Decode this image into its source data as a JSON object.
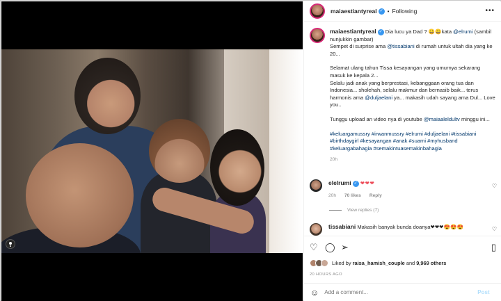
{
  "post": {
    "username": "maiaestiantyreal",
    "following_label": "Following",
    "more_label": "•••"
  },
  "caption": {
    "username": "maiaestiantyreal",
    "line1_a": " Dia lucu ya Dad ? 😀😀kata ",
    "line1_mention": "@elrumi",
    "line1_b": " (sambil nunjukkin gambar)",
    "line2_a": "Sempet di surprise ama ",
    "line2_mention": "@tissabiani",
    "line2_b": " di rumah untuk ultah dia yang ke 20...",
    "para2": "Selamat ulang tahun Tissa kesayangan yang umurnya sekarang masuk ke kepala 2...\nSelalu jadi anak yang berprestasi, kebanggaan orang tua dan Indonesia... sholehah, selalu makmur dan bernasib baik... terus harmonis ama ",
    "para2_mention": "@duljaelani",
    "para2_b": " ya... makasih udah sayang ama Dul... Love you..",
    "para3_a": "Tunggu upload an video nya di youtube ",
    "para3_mention": "@maiaaleldultv",
    "para3_b": " minggu ini...",
    "hashtags": "#keluargamussry #irwanmussry #elrumi #duljaelani #tissabiani #birthdaygirl #kesayangan #anak #suami #myhusband #keluargabahagia #semakintuasemakinbahagia",
    "time": "20h"
  },
  "comments": [
    {
      "username": "elelrumi",
      "text": "❤❤❤",
      "time": "20h",
      "likes": "70 likes",
      "reply_label": "Reply",
      "view_replies": "View replies (7)"
    },
    {
      "username": "tissabiani",
      "text": " Makasih banyak bunda doanya❤❤❤😍😍😍"
    }
  ],
  "likes": {
    "prefix": "Liked by ",
    "user": "raisa_hamish_couple",
    "middle": " and ",
    "count": "9,969 others"
  },
  "timestamp": "20 HOURS AGO",
  "add_comment": {
    "placeholder": "Add a comment...",
    "post_label": "Post"
  },
  "icons": {
    "verified": "verified-badge-icon",
    "like": "heart-icon",
    "comment": "comment-icon",
    "share": "share-icon",
    "save": "bookmark-icon",
    "emoji": "emoji-icon",
    "tagged": "user-tag-icon"
  },
  "colors": {
    "mention": "#00376b",
    "verified": "#3897f0",
    "heart": "#ed4956",
    "post_disabled": "#b2dffc"
  }
}
